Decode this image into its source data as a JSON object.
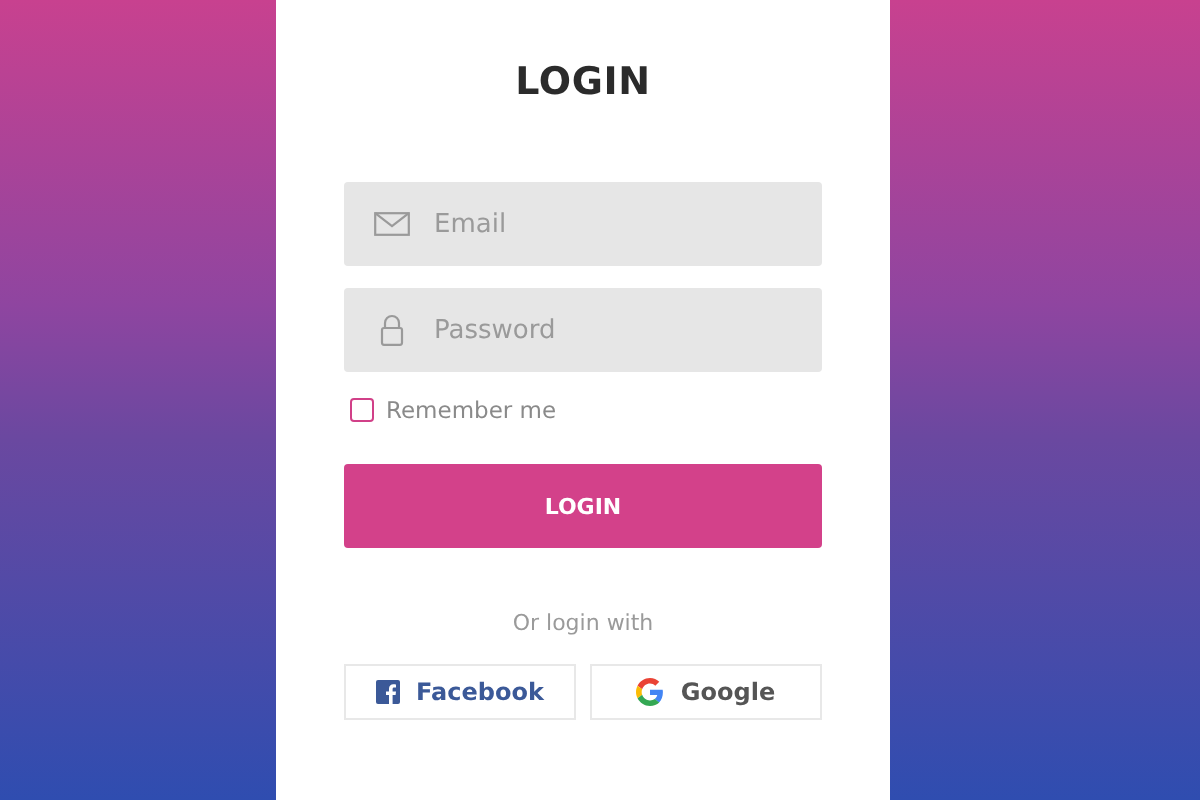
{
  "title": "LOGIN",
  "fields": [
    {
      "kind": "email",
      "placeholder": "Email"
    },
    {
      "kind": "password",
      "placeholder": "Password"
    }
  ],
  "remember": {
    "label": "Remember me",
    "checked": false
  },
  "submit": "LOGIN",
  "divider_text": "Or login with",
  "social": [
    {
      "kind": "facebook",
      "label": "Facebook"
    },
    {
      "kind": "google",
      "label": "Google"
    }
  ]
}
